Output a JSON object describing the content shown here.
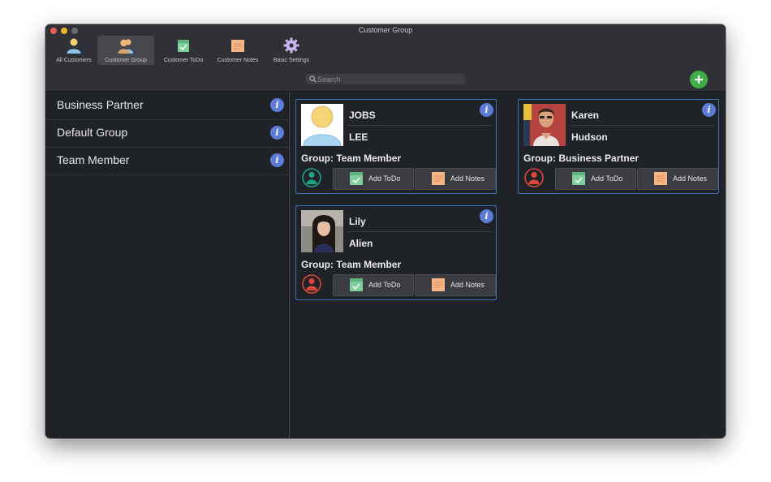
{
  "window": {
    "title": "Customer Group"
  },
  "toolbar": {
    "items": [
      {
        "label": "All Customers",
        "icon": "person-icon"
      },
      {
        "label": "Customer Group",
        "icon": "group-icon",
        "active": true
      },
      {
        "label": "Customer ToDo",
        "icon": "todo-icon"
      },
      {
        "label": "Customer Notes",
        "icon": "notes-icon"
      },
      {
        "label": "Basic Settings",
        "icon": "gear-icon"
      }
    ]
  },
  "search": {
    "placeholder": "Search",
    "value": ""
  },
  "colors": {
    "accent": "#5c7cd8",
    "add_green": "#3fae48",
    "card_border": "#3d6fc0",
    "status_green": "#1ca386",
    "status_red": "#e0463c"
  },
  "sidebar": {
    "groups": [
      {
        "label": "Business Partner"
      },
      {
        "label": "Default Group"
      },
      {
        "label": "Team Member"
      }
    ]
  },
  "cards": [
    {
      "first_name": "JOBS",
      "last_name": "LEE",
      "group": "Group: Team Member",
      "status": "green",
      "photo": "placeholder",
      "todo_label": "Add ToDo",
      "notes_label": "Add Notes"
    },
    {
      "first_name": "Karen",
      "last_name": "Hudson",
      "group": "Group: Business Partner",
      "status": "red",
      "photo": "photo",
      "todo_label": "Add ToDo",
      "notes_label": "Add Notes"
    },
    {
      "first_name": "Lily",
      "last_name": "Alien",
      "group": "Group: Team Member",
      "status": "red",
      "photo": "photo",
      "todo_label": "Add ToDo",
      "notes_label": "Add Notes"
    }
  ]
}
